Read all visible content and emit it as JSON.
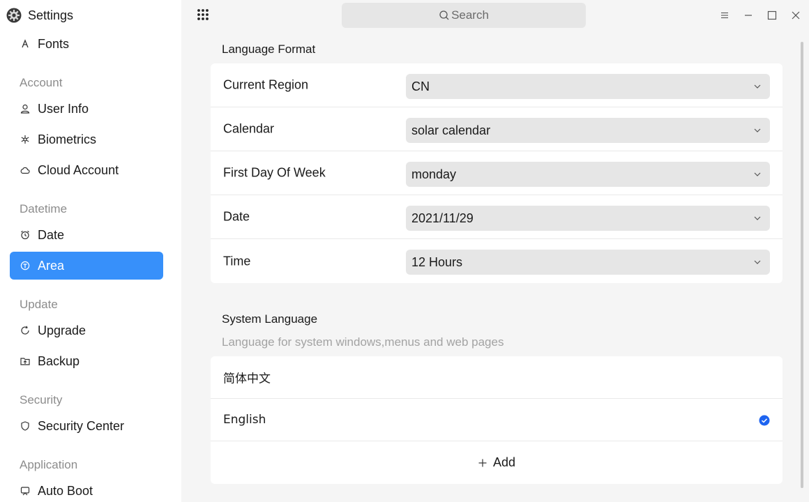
{
  "app": {
    "title": "Settings"
  },
  "sidebar": {
    "cut_item": {
      "label": "Fonts",
      "icon": "font-icon"
    },
    "sections": [
      {
        "title": "Account",
        "items": [
          {
            "label": "User Info",
            "icon": "user-icon"
          },
          {
            "label": "Biometrics",
            "icon": "biometrics-icon"
          },
          {
            "label": "Cloud Account",
            "icon": "cloud-icon"
          }
        ]
      },
      {
        "title": "Datetime",
        "items": [
          {
            "label": "Date",
            "icon": "alarm-clock-icon"
          },
          {
            "label": "Area",
            "icon": "area-icon",
            "active": true
          }
        ]
      },
      {
        "title": "Update",
        "items": [
          {
            "label": "Upgrade",
            "icon": "refresh-icon"
          },
          {
            "label": "Backup",
            "icon": "backup-icon"
          }
        ]
      },
      {
        "title": "Security",
        "items": [
          {
            "label": "Security Center",
            "icon": "shield-icon"
          }
        ]
      },
      {
        "title": "Application",
        "items": [
          {
            "label": "Auto Boot",
            "icon": "autoboot-icon"
          }
        ]
      }
    ]
  },
  "topbar": {
    "search_placeholder": "Search",
    "controls": [
      "menu-icon",
      "minimize-icon",
      "maximize-icon",
      "close-icon"
    ]
  },
  "language_format": {
    "title": "Language Format",
    "rows": [
      {
        "label": "Current Region",
        "value": "CN"
      },
      {
        "label": "Calendar",
        "value": "solar calendar"
      },
      {
        "label": "First Day Of Week",
        "value": "monday"
      },
      {
        "label": "Date",
        "value": "2021/11/29"
      },
      {
        "label": "Time",
        "value": "12 Hours"
      }
    ]
  },
  "system_language": {
    "title": "System Language",
    "subtitle": "Language for system windows,menus and web pages",
    "languages": [
      {
        "label": "简体中文",
        "selected": false
      },
      {
        "label": "English",
        "selected": true
      }
    ],
    "add_label": "Add"
  },
  "colors": {
    "accent": "#3790fa",
    "check": "#1e64f0"
  }
}
